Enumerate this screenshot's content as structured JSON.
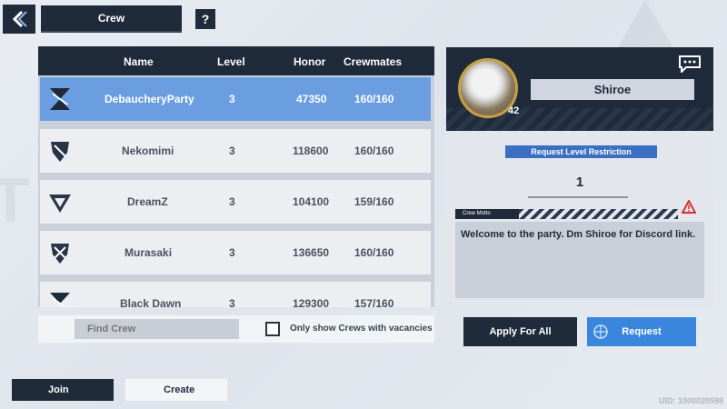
{
  "header": {
    "title": "Crew",
    "help_label": "?"
  },
  "table": {
    "columns": [
      "Name",
      "Level",
      "Honor",
      "Crewmates"
    ],
    "rows": [
      {
        "name": "DebaucheryParty",
        "level": "3",
        "honor": "47350",
        "crewmates": "160/160",
        "selected": true
      },
      {
        "name": "Nekomimi",
        "level": "3",
        "honor": "118600",
        "crewmates": "160/160",
        "selected": false
      },
      {
        "name": "DreamZ",
        "level": "3",
        "honor": "104100",
        "crewmates": "159/160",
        "selected": false
      },
      {
        "name": "Murasaki",
        "level": "3",
        "honor": "136650",
        "crewmates": "160/160",
        "selected": false
      },
      {
        "name": "Black Dawn",
        "level": "3",
        "honor": "129300",
        "crewmates": "157/160",
        "selected": false
      }
    ]
  },
  "search": {
    "placeholder": "Find Crew",
    "vacancies_label": "Only show Crews with vacancies",
    "vacancies_checked": false
  },
  "crew_detail": {
    "leader_name": "Shiroe",
    "leader_level": "42",
    "request_label": "Request Level Restriction",
    "request_value": "1",
    "motto_label": "Crew Motto",
    "motto_text": "Welcome to the party. Dm Shiroe for Discord link."
  },
  "actions": {
    "apply_all": "Apply For All",
    "request": "Request",
    "join": "Join",
    "create": "Create"
  },
  "footer": {
    "uid": "UID: 1000020598"
  },
  "colors": {
    "dark": "#1f2a3a",
    "accent_blue": "#3a86dd",
    "selected_row": "#6a9ee0"
  }
}
